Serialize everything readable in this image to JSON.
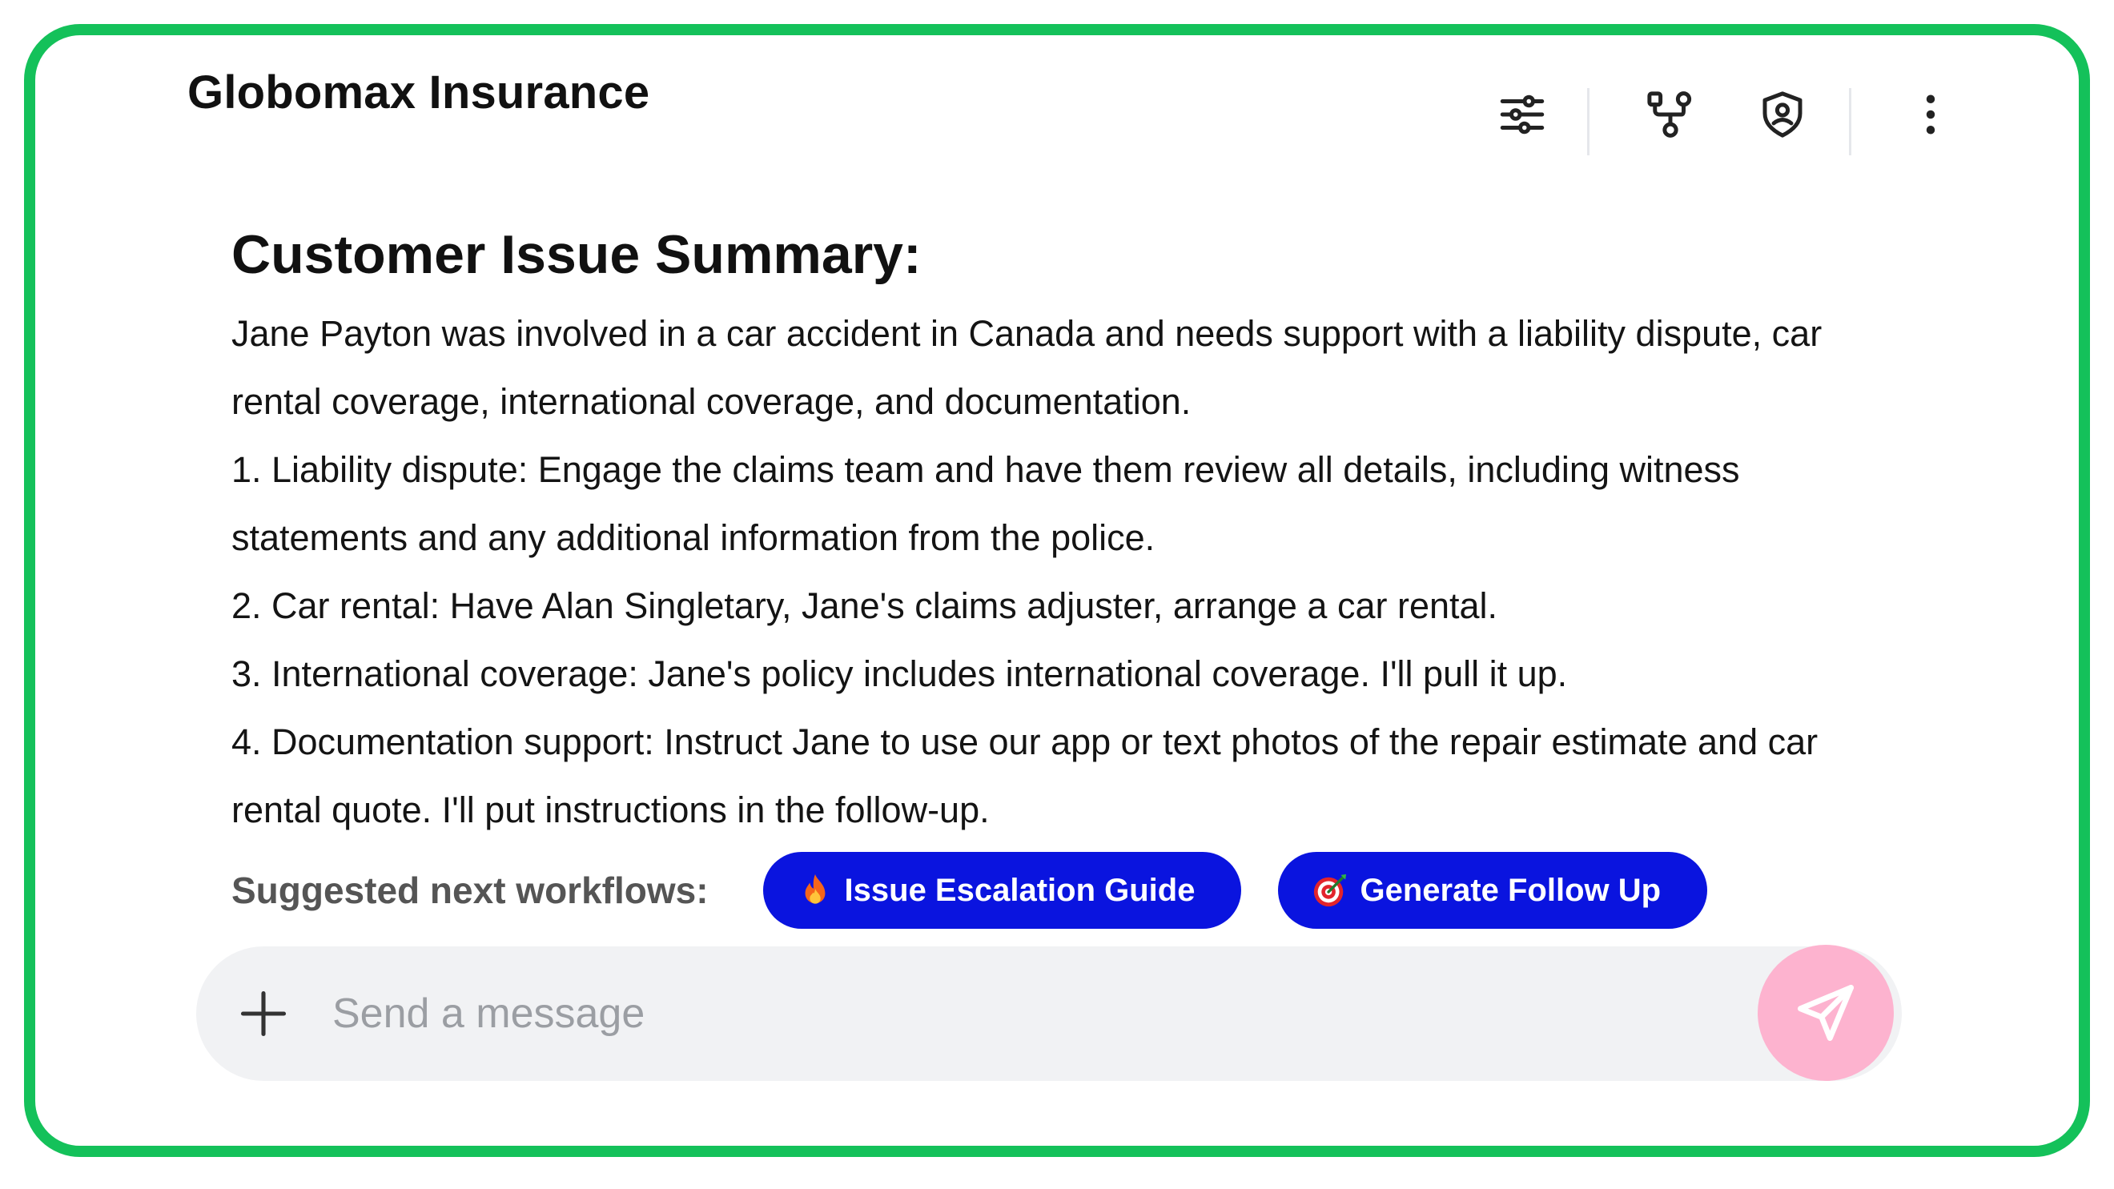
{
  "app": {
    "title": "Globomax Insurance",
    "accent_color": "#14c15a",
    "button_color": "#0a14df",
    "send_color": "#fdb3cf"
  },
  "toolbar": {
    "icons": [
      "sliders-icon",
      "workflow-icon",
      "shield-icon",
      "more-vertical-icon"
    ]
  },
  "summary": {
    "heading": "Customer Issue Summary:",
    "intro": "Jane Payton was involved in a car accident in Canada and needs support with a liability dispute, car rental coverage, international coverage, and documentation.",
    "items": [
      "1. Liability dispute: Engage the claims team and have them review all details, including witness statements and any additional information from the police.",
      "2. Car rental: Have Alan Singletary, Jane's claims adjuster, arrange a car rental.",
      "3. International coverage: Jane's policy includes international coverage. I'll pull it up.",
      "4. Documentation support: Instruct Jane to use our app or text photos of the repair estimate and car rental quote. I'll put instructions in the follow-up."
    ]
  },
  "workflows": {
    "label": "Suggested next workflows:",
    "buttons": [
      {
        "label": "Issue Escalation Guide",
        "icon": "fire-icon"
      },
      {
        "label": "Generate Follow Up",
        "icon": "target-icon"
      }
    ]
  },
  "composer": {
    "placeholder": "Send a message",
    "value": ""
  }
}
